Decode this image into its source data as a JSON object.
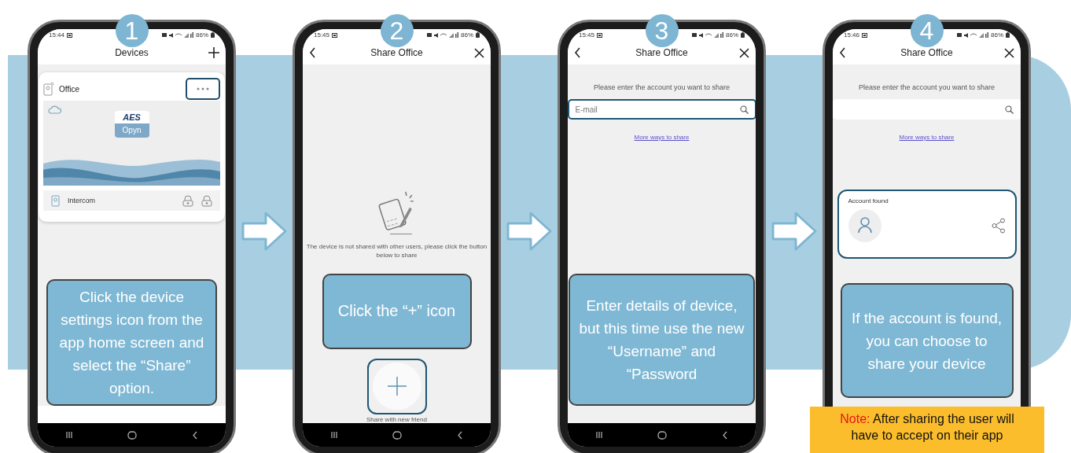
{
  "steps": [
    {
      "number": "1",
      "kind": "devices",
      "status": {
        "time": "15:44",
        "battery": "86%"
      },
      "header": {
        "title": "Devices"
      },
      "device_card": {
        "name": "Office",
        "menu_highlighted": true,
        "logo": {
          "top": "AES",
          "bottom": "Opyn"
        },
        "sub_device": "Intercom"
      },
      "callout": "Click the device settings icon from the app home screen and select the “Share” option."
    },
    {
      "number": "2",
      "kind": "empty",
      "status": {
        "time": "15:45",
        "battery": "86%"
      },
      "header": {
        "title": "Share Office"
      },
      "message": "The device is not shared with other users, please click the button below to share",
      "callout": "Click the “+” icon",
      "share_button": {
        "label": "Share with new friend",
        "highlighted": true
      }
    },
    {
      "number": "3",
      "kind": "search",
      "status": {
        "time": "15:45",
        "battery": "86%"
      },
      "header": {
        "title": "Share Office"
      },
      "prompt": "Please enter the account you want to share",
      "field": {
        "placeholder": "E-mail",
        "highlighted": true
      },
      "link": "More ways to share",
      "callout": "Enter details of device, but this time use the new “Username” and “Password"
    },
    {
      "number": "4",
      "kind": "found",
      "status": {
        "time": "15:46",
        "battery": "86%"
      },
      "header": {
        "title": "Share Office"
      },
      "prompt": "Please enter the account you want to share",
      "field": {
        "highlighted": false
      },
      "link": "More ways to share",
      "result": {
        "label": "Account found",
        "highlighted": true
      },
      "callout": "If the account is found, you can choose to share your device"
    }
  ],
  "note": {
    "label": "Note:",
    "text": "After sharing the user will have to accept on their app"
  }
}
